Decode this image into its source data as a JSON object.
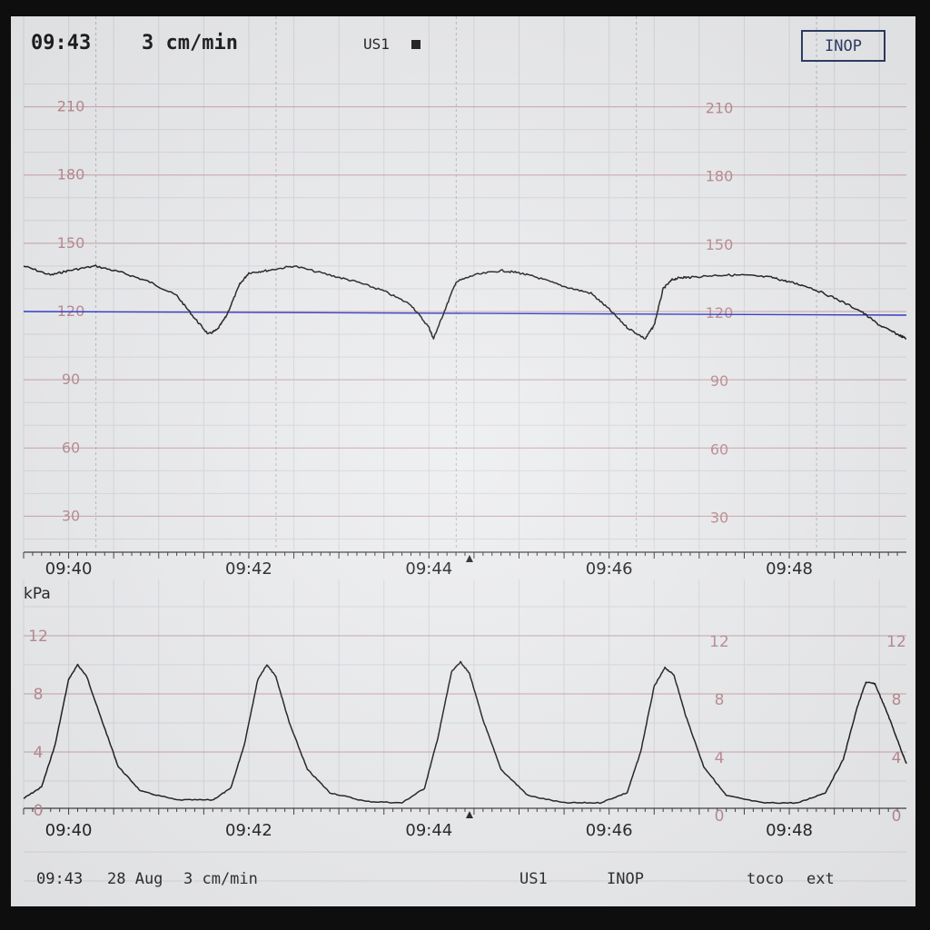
{
  "header": {
    "time": "09:43",
    "paper_speed": "3 cm/min",
    "transducer": "US1",
    "transducer_indicator_icon": "filled-square-icon",
    "status_button": "INOP"
  },
  "footer": {
    "time": "09:43",
    "date": "28 Aug",
    "paper_speed": "3 cm/min",
    "transducer": "US1",
    "status": "INOP",
    "toco_label": "toco",
    "ext_label": "ext"
  },
  "colors": {
    "trace": "#1a1a1a",
    "baseline": "#2b35c8",
    "grid_major": "#c9a2a8",
    "grid_minor": "#d6d8de",
    "scale_label": "#b98a90"
  },
  "chart_data": [
    {
      "type": "line",
      "name": "fetal-heart-rate",
      "ylim": [
        15,
        225
      ],
      "y_ticks": [
        30,
        60,
        90,
        120,
        150,
        180,
        210
      ],
      "x_ticks": [
        "09:40",
        "09:42",
        "09:44",
        "09:46",
        "09:48"
      ],
      "xlim_minutes": [
        39.5,
        49.3
      ],
      "baseline": 120,
      "x": [
        39.5,
        39.8,
        40.0,
        40.3,
        40.6,
        40.9,
        41.2,
        41.4,
        41.55,
        41.65,
        41.75,
        41.9,
        42.0,
        42.2,
        42.5,
        42.9,
        43.2,
        43.5,
        43.8,
        44.0,
        44.05,
        44.15,
        44.3,
        44.5,
        44.8,
        45.0,
        45.2,
        45.5,
        45.8,
        46.0,
        46.2,
        46.4,
        46.5,
        46.6,
        46.7,
        46.8,
        46.9,
        47.2,
        47.5,
        47.8,
        48.0,
        48.2,
        48.5,
        48.8,
        49.0,
        49.2,
        49.3
      ],
      "y": [
        140,
        136,
        138,
        140,
        137,
        133,
        127,
        117,
        110,
        112,
        118,
        132,
        137,
        138,
        140,
        136,
        133,
        129,
        123,
        113,
        108,
        118,
        133,
        136,
        138,
        137,
        135,
        131,
        128,
        121,
        113,
        108,
        114,
        130,
        134,
        135,
        135,
        136,
        136,
        135,
        133,
        131,
        126,
        120,
        114,
        110,
        108
      ]
    },
    {
      "type": "line",
      "name": "uterine-activity",
      "ylabel": "kPa",
      "ylim": [
        0,
        14
      ],
      "y_ticks": [
        0,
        4,
        8,
        12
      ],
      "x_ticks": [
        "09:40",
        "09:42",
        "09:44",
        "09:46",
        "09:48"
      ],
      "xlim_minutes": [
        39.5,
        49.3
      ],
      "x": [
        39.5,
        39.7,
        39.85,
        40.0,
        40.1,
        40.2,
        40.35,
        40.55,
        40.8,
        41.2,
        41.6,
        41.8,
        41.95,
        42.1,
        42.2,
        42.3,
        42.45,
        42.65,
        42.9,
        43.3,
        43.7,
        43.95,
        44.1,
        44.25,
        44.35,
        44.45,
        44.6,
        44.8,
        45.1,
        45.5,
        45.9,
        46.2,
        46.35,
        46.5,
        46.62,
        46.72,
        46.85,
        47.05,
        47.3,
        47.7,
        48.1,
        48.4,
        48.6,
        48.75,
        48.85,
        48.95,
        49.1,
        49.25,
        49.3
      ],
      "y": [
        0.8,
        1.6,
        4.5,
        9.0,
        10.0,
        9.2,
        6.5,
        3.0,
        1.3,
        0.7,
        0.7,
        1.5,
        4.5,
        9.0,
        10.0,
        9.2,
        6.0,
        2.8,
        1.2,
        0.6,
        0.5,
        1.5,
        5.0,
        9.5,
        10.2,
        9.4,
        6.2,
        2.8,
        1.0,
        0.5,
        0.5,
        1.2,
        4.0,
        8.5,
        9.8,
        9.3,
        6.5,
        3.0,
        1.0,
        0.5,
        0.5,
        1.2,
        3.5,
        7.0,
        8.8,
        8.7,
        6.5,
        4.0,
        3.2
      ]
    }
  ]
}
